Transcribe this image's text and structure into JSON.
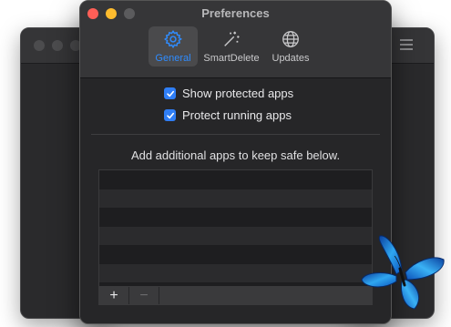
{
  "window": {
    "title": "Preferences"
  },
  "tabs": [
    {
      "label": "General",
      "icon": "gear-icon",
      "active": true
    },
    {
      "label": "SmartDelete",
      "icon": "magic-wand-icon",
      "active": false
    },
    {
      "label": "Updates",
      "icon": "globe-icon",
      "active": false
    }
  ],
  "options": {
    "show_protected": {
      "label": "Show protected apps",
      "checked": true
    },
    "protect_running": {
      "label": "Protect running apps",
      "checked": true
    }
  },
  "hint": "Add additional apps to keep safe below.",
  "list_controls": {
    "add_label": "+",
    "remove_label": "−"
  },
  "colors": {
    "accent": "#2f8cff",
    "checkbox": "#2f7ef6",
    "close": "#ff5f57",
    "minimize": "#febc2e"
  }
}
